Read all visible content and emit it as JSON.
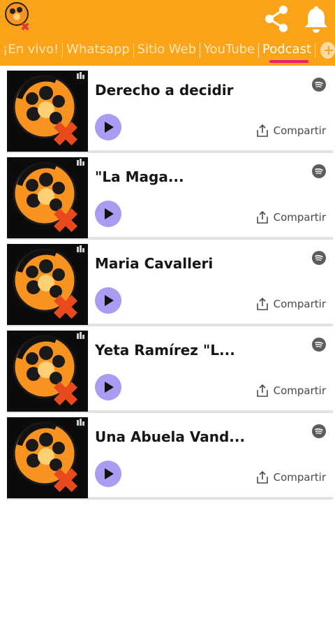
{
  "header": {
    "share_icon": "share-icon",
    "bell_icon": "bell-icon",
    "accent_color": "#fba319"
  },
  "nav": {
    "tabs": [
      "¡En vivo!",
      "Whatsapp",
      "Sitio Web",
      "YouTube",
      "Podcast"
    ],
    "active_tab": "Podcast",
    "add_icon": "plus-icon",
    "active_underline_color": "#f21b74"
  },
  "episodes": [
    {
      "title": "Derecho a decidir",
      "share_label": "Compartir"
    },
    {
      "title": "\"La Maga...",
      "share_label": "Compartir"
    },
    {
      "title": "Maria Cavalleri",
      "share_label": "Compartir"
    },
    {
      "title": "Yeta Ramírez \"L...",
      "share_label": "Compartir"
    },
    {
      "title": "Una Abuela Vand...",
      "share_label": "Compartir"
    }
  ],
  "colors": {
    "play_button": "#a99cf2",
    "card_divider": "#e2e2e2"
  }
}
